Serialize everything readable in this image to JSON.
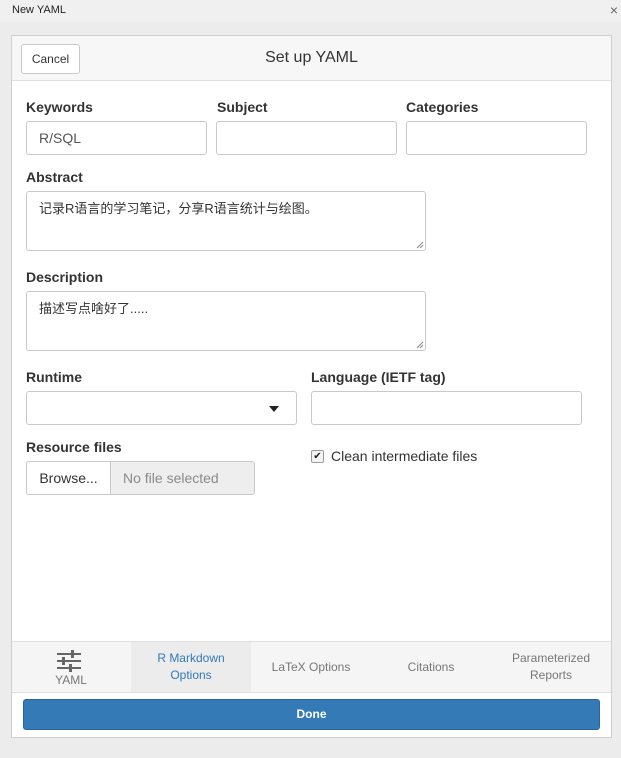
{
  "window": {
    "title": "New YAML",
    "close_glyph": "×"
  },
  "header": {
    "cancel_label": "Cancel",
    "title": "Set up YAML"
  },
  "fields": {
    "keywords": {
      "label": "Keywords",
      "value": "R/SQL"
    },
    "subject": {
      "label": "Subject",
      "value": ""
    },
    "categories": {
      "label": "Categories",
      "value": ""
    },
    "abstract": {
      "label": "Abstract",
      "value": "记录R语言的学习笔记，分享R语言统计与绘图。"
    },
    "description": {
      "label": "Description",
      "value": "描述写点啥好了....."
    },
    "runtime": {
      "label": "Runtime",
      "value": ""
    },
    "language": {
      "label": "Language (IETF tag)",
      "value": ""
    },
    "resource_files": {
      "label": "Resource files",
      "browse_label": "Browse...",
      "file_placeholder": "No file selected"
    },
    "clean_intermediate": {
      "label": "Clean intermediate files",
      "checked": true,
      "check_glyph": "✔"
    }
  },
  "tabs": [
    {
      "label": "YAML",
      "icon": "sliders-icon",
      "active": false
    },
    {
      "label_line1": "R Markdown",
      "label_line2": "Options",
      "active": true
    },
    {
      "label": "LaTeX Options",
      "active": false
    },
    {
      "label": "Citations",
      "active": false
    },
    {
      "label_line1": "Parameterized",
      "label_line2": "Reports",
      "active": false
    }
  ],
  "done_label": "Done",
  "colors": {
    "accent": "#337ab7",
    "active_tab_text": "#337ab7",
    "tab_text": "#777777"
  }
}
